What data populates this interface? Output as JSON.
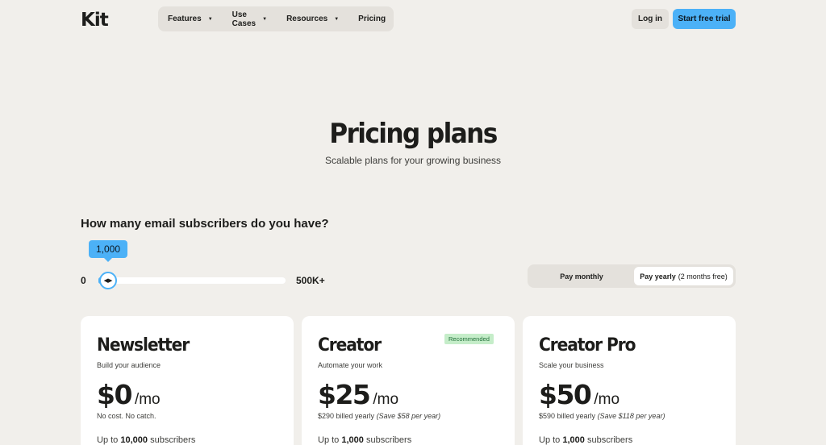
{
  "brand": {
    "logo": "Kit"
  },
  "nav": {
    "items": [
      {
        "label": "Features",
        "dropdown": true
      },
      {
        "label": "Use Cases",
        "dropdown": true
      },
      {
        "label": "Resources",
        "dropdown": true
      },
      {
        "label": "Pricing",
        "dropdown": false
      }
    ],
    "login": "Log in",
    "trial": "Start free trial"
  },
  "hero": {
    "title": "Pricing plans",
    "subtitle": "Scalable plans for your growing business"
  },
  "subscribers": {
    "question": "How many email subscribers do you have?",
    "value_label": "1,000",
    "min_label": "0",
    "max_label": "500K+",
    "fraction": 0.02
  },
  "billing": {
    "monthly": "Pay monthly",
    "yearly": "Pay yearly",
    "yearly_note": "(2 months free)",
    "selected": "yearly"
  },
  "plans": [
    {
      "name": "Newsletter",
      "tagline": "Build your audience",
      "price": "$0",
      "per": "/mo",
      "billed": "No cost. No catch.",
      "save": "",
      "subs_prefix": "Up to",
      "subs_count": "10,000",
      "subs_suffix": "subscribers",
      "badge": ""
    },
    {
      "name": "Creator",
      "tagline": "Automate your work",
      "price": "$25",
      "per": "/mo",
      "billed": "$290 billed yearly",
      "save": "(Save $58 per year)",
      "subs_prefix": "Up to",
      "subs_count": "1,000",
      "subs_suffix": "subscribers",
      "badge": "Recommended"
    },
    {
      "name": "Creator Pro",
      "tagline": "Scale your business",
      "price": "$50",
      "per": "/mo",
      "billed": "$590 billed yearly",
      "save": "(Save $118 per year)",
      "subs_prefix": "Up to",
      "subs_count": "1,000",
      "subs_suffix": "subscribers",
      "badge": ""
    }
  ],
  "colors": {
    "accent": "#4cb1f7",
    "background": "#f1efeb",
    "badge_bg": "#c5edc9"
  }
}
